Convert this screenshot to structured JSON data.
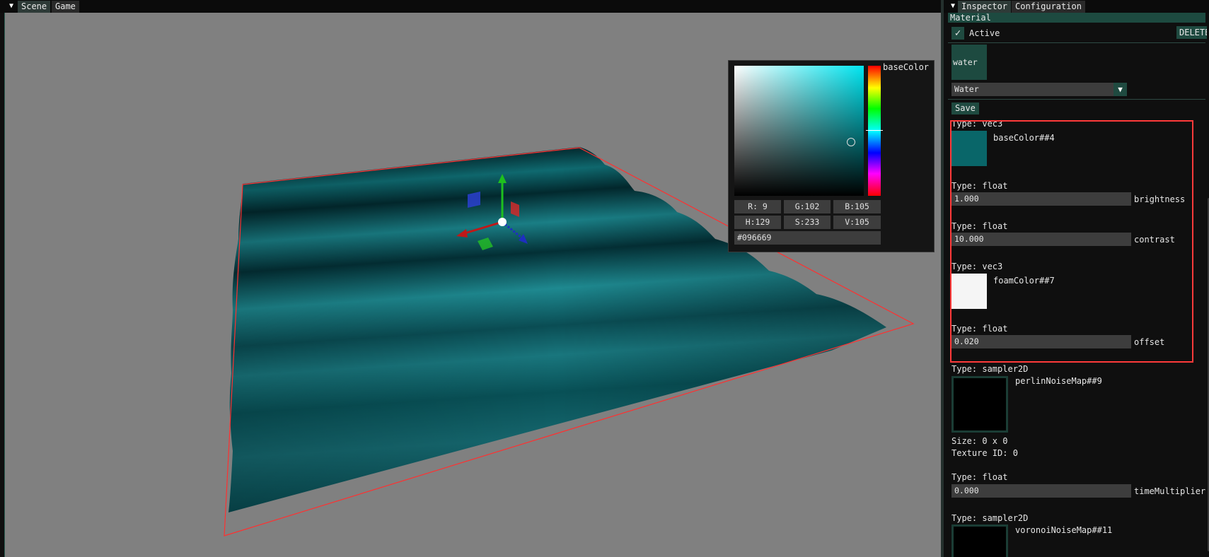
{
  "scene_panel": {
    "tabs": [
      "Scene",
      "Game"
    ]
  },
  "color_picker": {
    "label": "baseColor",
    "r": "R:  9",
    "g": "G:102",
    "b": "B:105",
    "h": "H:129",
    "s": "S:233",
    "v": "V:105",
    "hex": "#096669"
  },
  "inspector": {
    "tabs": [
      "Inspector",
      "Configuration"
    ],
    "header": "Material",
    "active_label": "Active",
    "delete_label": "DELETE",
    "material_thumb_label": "water",
    "shader_dropdown": "Water",
    "save_label": "Save",
    "uniforms": {
      "base_color": {
        "type": "Type: vec3",
        "name": "baseColor##4",
        "color": "#096669"
      },
      "brightness": {
        "type": "Type: float",
        "value": "1.000",
        "name": "brightness"
      },
      "contrast": {
        "type": "Type: float",
        "value": "10.000",
        "name": "contrast"
      },
      "foam_color": {
        "type": "Type: vec3",
        "name": "foamColor##7",
        "color": "#f5f5f5"
      },
      "offset": {
        "type": "Type: float",
        "value": "0.020",
        "name": "offset"
      },
      "perlin": {
        "type": "Type: sampler2D",
        "name": "perlinNoiseMap##9",
        "size": "Size: 0 x 0",
        "texture_id": "Texture ID: 0"
      },
      "time_multiplier": {
        "type": "Type: float",
        "value": "0.000",
        "name": "timeMultiplier"
      },
      "voronoi": {
        "type": "Type: sampler2D",
        "name": "voronoiNoiseMap##11"
      }
    }
  },
  "colors": {
    "accent": "#1f4a40",
    "viewport_bg": "#808080",
    "water": "#0b5c63",
    "selection": "#ff3a3a"
  },
  "icons": [
    "collapse-arrow-icon",
    "checkmark-icon",
    "dropdown-arrow-icon",
    "translate-gizmo-icon"
  ]
}
